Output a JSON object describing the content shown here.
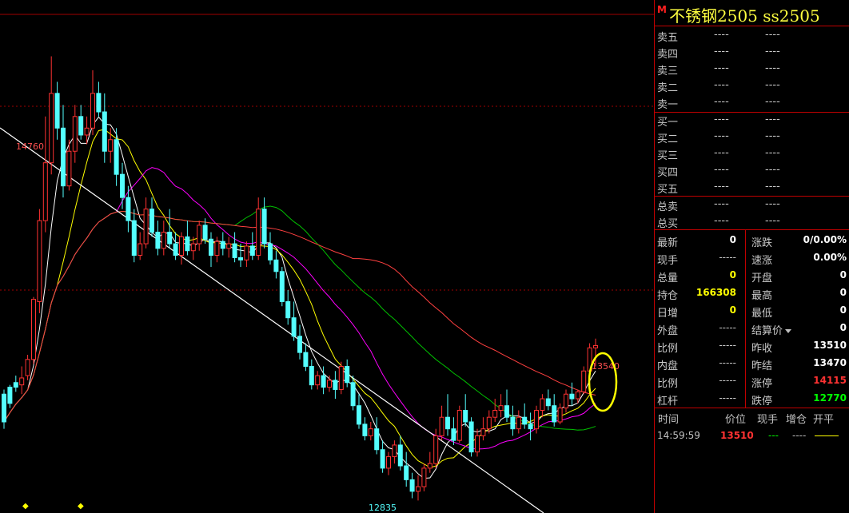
{
  "colors": {
    "up": "#ff3232",
    "down": "#54ffff",
    "ma_white": "#ffffff",
    "ma_yellow": "#ffff00",
    "ma_magenta": "#ff00ff",
    "ma_green": "#00c000",
    "ma_red": "#ff4040",
    "grid_red": "#a00000",
    "highlight_circle": "#ffff00"
  },
  "header": {
    "marker": "M",
    "title": "不锈钢2505  ss2505"
  },
  "sell_levels": [
    {
      "label": "卖五",
      "price": "----",
      "vol": "----"
    },
    {
      "label": "卖四",
      "price": "----",
      "vol": "----"
    },
    {
      "label": "卖三",
      "price": "----",
      "vol": "----"
    },
    {
      "label": "卖二",
      "price": "----",
      "vol": "----"
    },
    {
      "label": "卖一",
      "price": "----",
      "vol": "----"
    }
  ],
  "buy_levels": [
    {
      "label": "买一",
      "price": "----",
      "vol": "----"
    },
    {
      "label": "买二",
      "price": "----",
      "vol": "----"
    },
    {
      "label": "买三",
      "price": "----",
      "vol": "----"
    },
    {
      "label": "买四",
      "price": "----",
      "vol": "----"
    },
    {
      "label": "买五",
      "price": "----",
      "vol": "----"
    }
  ],
  "totals": [
    {
      "label": "总卖",
      "v1": "----",
      "v2": "----"
    },
    {
      "label": "总买",
      "v1": "----",
      "v2": "----"
    }
  ],
  "quote_left": [
    {
      "label": "最新",
      "value": "0",
      "color": "#ffffff"
    },
    {
      "label": "现手",
      "value": "-----",
      "color": "dash"
    },
    {
      "label": "总量",
      "value": "0",
      "color": "#ffff00"
    },
    {
      "label": "持仓",
      "value": "166308",
      "color": "#ffff00"
    },
    {
      "label": "日增",
      "value": "0",
      "color": "#ffff00"
    },
    {
      "label": "外盘",
      "value": "-----",
      "color": "dash"
    },
    {
      "label": "比例",
      "value": "-----",
      "color": "dash"
    },
    {
      "label": "内盘",
      "value": "-----",
      "color": "dash"
    },
    {
      "label": "比例",
      "value": "-----",
      "color": "dash"
    },
    {
      "label": "杠杆",
      "value": "-----",
      "color": "dash"
    }
  ],
  "quote_right": [
    {
      "label": "涨跌",
      "value": "0/0.00%",
      "color": "#ffffff"
    },
    {
      "label": "速涨",
      "value": "0.00%",
      "color": "#ffffff"
    },
    {
      "label": "开盘",
      "value": "0",
      "color": "#ffffff"
    },
    {
      "label": "最高",
      "value": "0",
      "color": "#ffffff"
    },
    {
      "label": "最低",
      "value": "0",
      "color": "#ffffff"
    },
    {
      "label": "结算价",
      "value": "0",
      "color": "#ffffff",
      "dropdown": true
    },
    {
      "label": "昨收",
      "value": "13510",
      "color": "#ffffff"
    },
    {
      "label": "昨结",
      "value": "13470",
      "color": "#ffffff"
    },
    {
      "label": "涨停",
      "value": "14115",
      "color": "#ff3232"
    },
    {
      "label": "跌停",
      "value": "12770",
      "color": "#00ff00"
    }
  ],
  "ticks": {
    "headers": [
      "时间",
      "价位",
      "现手",
      "增仓",
      "开平"
    ],
    "rows": [
      {
        "time": "14:59:59",
        "price": "13510",
        "vol": "---",
        "oi": "----",
        "flag": ""
      }
    ]
  },
  "chart_data": {
    "type": "candlestick",
    "ylim": [
      12800,
      14900
    ],
    "annotations": {
      "high_label": "14760",
      "low_label": "12835",
      "last_label": "13540"
    },
    "candles": [
      [
        13300,
        13320,
        13180,
        13150
      ],
      [
        13330,
        13340,
        13260,
        13240
      ],
      [
        13350,
        13380,
        13330,
        13310
      ],
      [
        13340,
        13420,
        13370,
        13300
      ],
      [
        13380,
        13470,
        13450,
        13360
      ],
      [
        13450,
        13720,
        13710,
        13430
      ],
      [
        13700,
        14100,
        14050,
        13650
      ],
      [
        14050,
        14500,
        14300,
        14000
      ],
      [
        14300,
        14760,
        14600,
        14250
      ],
      [
        14600,
        14650,
        14450,
        14400
      ],
      [
        14450,
        14550,
        14200,
        14150
      ],
      [
        14200,
        14400,
        14350,
        14180
      ],
      [
        14350,
        14550,
        14500,
        14300
      ],
      [
        14500,
        14550,
        14420,
        14400
      ],
      [
        14420,
        14500,
        14450,
        14380
      ],
      [
        14450,
        14700,
        14600,
        14420
      ],
      [
        14600,
        14650,
        14520,
        14500
      ],
      [
        14520,
        14600,
        14350,
        14300
      ],
      [
        14350,
        14450,
        14400,
        14300
      ],
      [
        14400,
        14450,
        14250,
        14200
      ],
      [
        14250,
        14300,
        14150,
        14100
      ],
      [
        14150,
        14200,
        14050,
        14000
      ],
      [
        14050,
        14100,
        13900,
        13870
      ],
      [
        13900,
        14000,
        13950,
        13880
      ],
      [
        13950,
        14150,
        14100,
        13930
      ],
      [
        14100,
        14150,
        14000,
        13980
      ],
      [
        14000,
        14050,
        13930,
        13900
      ],
      [
        13930,
        14050,
        14000,
        13900
      ],
      [
        14000,
        14100,
        13950,
        13930
      ],
      [
        13950,
        14000,
        13900,
        13880
      ],
      [
        13900,
        14000,
        13980,
        13860
      ],
      [
        13980,
        14050,
        13920,
        13900
      ],
      [
        13920,
        13980,
        13950,
        13880
      ],
      [
        13950,
        14050,
        14030,
        13920
      ],
      [
        14030,
        14060,
        13970,
        13950
      ],
      [
        13970,
        14000,
        13900,
        13850
      ],
      [
        13900,
        13980,
        13960,
        13870
      ],
      [
        13960,
        14000,
        13930,
        13900
      ],
      [
        13930,
        13980,
        13950,
        13890
      ],
      [
        13950,
        14000,
        13890,
        13870
      ],
      [
        13890,
        13950,
        13880,
        13850
      ],
      [
        13880,
        13960,
        13940,
        13850
      ],
      [
        13940,
        14000,
        13900,
        13880
      ],
      [
        13900,
        14150,
        14100,
        13880
      ],
      [
        14100,
        14150,
        13950,
        13930
      ],
      [
        13950,
        14000,
        13880,
        13860
      ],
      [
        13880,
        13920,
        13830,
        13800
      ],
      [
        13830,
        13850,
        13700,
        13680
      ],
      [
        13700,
        13750,
        13630,
        13600
      ],
      [
        13630,
        13700,
        13550,
        13530
      ],
      [
        13550,
        13600,
        13480,
        13450
      ],
      [
        13480,
        13520,
        13420,
        13400
      ],
      [
        13420,
        13450,
        13340,
        13320
      ],
      [
        13340,
        13400,
        13380,
        13320
      ],
      [
        13380,
        13420,
        13330,
        13300
      ],
      [
        13330,
        13380,
        13360,
        13310
      ],
      [
        13360,
        13400,
        13320,
        13280
      ],
      [
        13320,
        13440,
        13420,
        13300
      ],
      [
        13420,
        13450,
        13350,
        13330
      ],
      [
        13350,
        13380,
        13250,
        13230
      ],
      [
        13250,
        13300,
        13170,
        13150
      ],
      [
        13170,
        13200,
        13120,
        13100
      ],
      [
        13120,
        13180,
        13150,
        13100
      ],
      [
        13150,
        13200,
        13060,
        13040
      ],
      [
        13060,
        13100,
        12980,
        12960
      ],
      [
        12980,
        13050,
        13030,
        12950
      ],
      [
        13030,
        13100,
        13080,
        13000
      ],
      [
        13080,
        13120,
        12990,
        12970
      ],
      [
        12990,
        13050,
        12930,
        12900
      ],
      [
        12930,
        12960,
        12880,
        12850
      ],
      [
        12880,
        12950,
        12900,
        12840
      ],
      [
        12900,
        13000,
        12980,
        12880
      ],
      [
        12980,
        13050,
        13000,
        12960
      ],
      [
        13000,
        13150,
        13120,
        12980
      ],
      [
        13120,
        13250,
        13200,
        13100
      ],
      [
        13200,
        13300,
        13150,
        13120
      ],
      [
        13150,
        13200,
        13100,
        13080
      ],
      [
        13100,
        13250,
        13230,
        13090
      ],
      [
        13230,
        13300,
        13180,
        13160
      ],
      [
        13180,
        13200,
        13050,
        13030
      ],
      [
        13050,
        13150,
        13120,
        13030
      ],
      [
        13120,
        13200,
        13150,
        13100
      ],
      [
        13150,
        13230,
        13200,
        13130
      ],
      [
        13200,
        13280,
        13230,
        13180
      ],
      [
        13230,
        13300,
        13250,
        13200
      ],
      [
        13250,
        13320,
        13200,
        13180
      ],
      [
        13200,
        13250,
        13150,
        13120
      ],
      [
        13150,
        13230,
        13200,
        13130
      ],
      [
        13200,
        13260,
        13170,
        13150
      ],
      [
        13170,
        13220,
        13150,
        13100
      ],
      [
        13150,
        13250,
        13230,
        13130
      ],
      [
        13230,
        13300,
        13280,
        13200
      ],
      [
        13280,
        13320,
        13250,
        13230
      ],
      [
        13250,
        13300,
        13180,
        13160
      ],
      [
        13180,
        13260,
        13240,
        13170
      ],
      [
        13240,
        13320,
        13300,
        13220
      ],
      [
        13300,
        13350,
        13280,
        13250
      ],
      [
        13280,
        13320,
        13310,
        13260
      ],
      [
        13310,
        13420,
        13400,
        13300
      ],
      [
        13400,
        13520,
        13500,
        13380
      ],
      [
        13500,
        13540,
        13510,
        13420
      ]
    ]
  }
}
